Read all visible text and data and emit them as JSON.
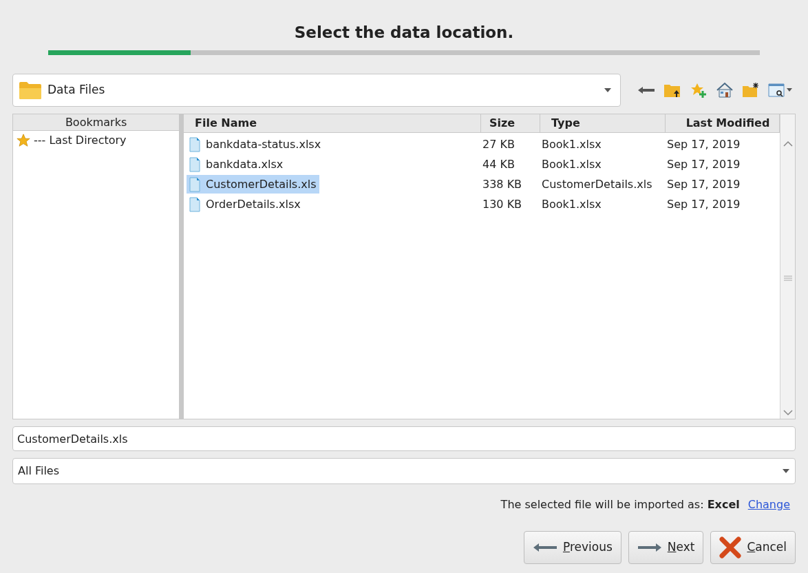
{
  "title": "Select the data location.",
  "progress": {
    "level": 0.2
  },
  "location": {
    "value": "Data Files"
  },
  "bookmarks": {
    "header": "Bookmarks",
    "items": [
      {
        "label": "--- Last Directory"
      }
    ]
  },
  "table": {
    "columns": [
      "File Name",
      "Size",
      "Type",
      "Last Modified"
    ],
    "rows": [
      {
        "cells": [
          "bankdata-status.xlsx",
          "27 KB",
          "Book1.xlsx",
          "Sep 17, 2019"
        ],
        "selected": false
      },
      {
        "cells": [
          "bankdata.xlsx",
          "44 KB",
          "Book1.xlsx",
          "Sep 17, 2019"
        ],
        "selected": false
      },
      {
        "cells": [
          "CustomerDetails.xls",
          "338 KB",
          "CustomerDetails.xls",
          "Sep 17, 2019"
        ],
        "selected": true
      },
      {
        "cells": [
          "OrderDetails.xlsx",
          "130 KB",
          "Book1.xlsx",
          "Sep 17, 2019"
        ],
        "selected": false
      }
    ]
  },
  "file_name": {
    "value": "CustomerDetails.xls"
  },
  "file_type": {
    "value": "All Files"
  },
  "import_note": {
    "text": "The selected file will be imported as: **Excel**",
    "link": "Change"
  },
  "buttons": [
    {
      "kind": "previous",
      "label": "Previous"
    },
    {
      "kind": "next",
      "label": "Next"
    },
    {
      "kind": "cancel",
      "label": "Cancel"
    }
  ]
}
